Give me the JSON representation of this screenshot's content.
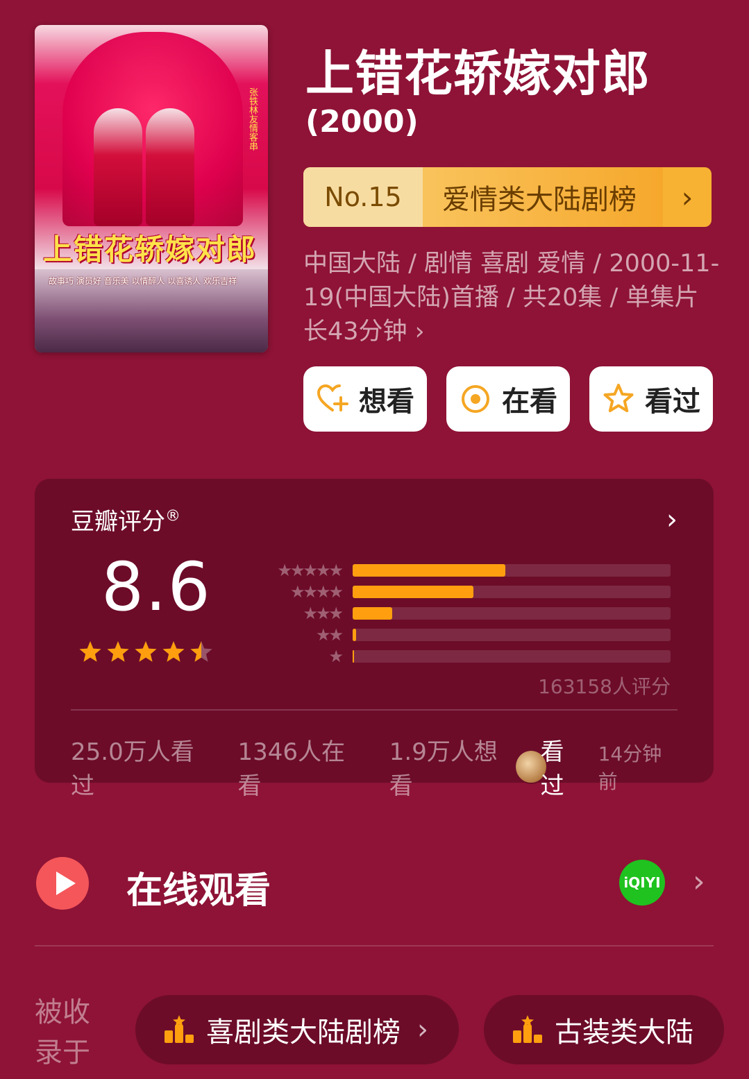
{
  "poster": {
    "title_art": "上错花轿嫁对郎",
    "credits": "故事巧 演员好 音乐美 以情醉人 以喜诱人 欢乐吉祥",
    "side_text": "张铁林友情客串"
  },
  "header": {
    "title": "上错花轿嫁对郎",
    "year": "(2000)"
  },
  "rank": {
    "number": "No.15",
    "name": "爱情类大陆剧榜"
  },
  "meta": {
    "text": "中国大陆 / 剧情 喜剧 爱情 / 2000-11-19(中国大陆)首播 / 共20集 / 单集片长43分钟 ›"
  },
  "actions": {
    "want": "想看",
    "watching": "在看",
    "watched": "看过"
  },
  "rating": {
    "label": "豆瓣评分",
    "reg": "®",
    "score": "8.6",
    "stars": 4.5,
    "distribution": [
      {
        "stars": 5,
        "percent": 48
      },
      {
        "stars": 4,
        "percent": 38
      },
      {
        "stars": 3,
        "percent": 12.5
      },
      {
        "stars": 2,
        "percent": 1
      },
      {
        "stars": 1,
        "percent": 0.5
      }
    ],
    "raters": "163158人评分",
    "counts": {
      "watched": "25.0万人看过",
      "watching": "1346人在看",
      "want": "1.9万人想看",
      "recent_action": "看过",
      "recent_time": "14分钟前"
    }
  },
  "online": {
    "label": "在线观看",
    "provider": "iQIYI"
  },
  "collections": {
    "label": "被收录于",
    "items": [
      "喜剧类大陆剧榜",
      "古装类大陆"
    ]
  },
  "colors": {
    "background": "#8e1336",
    "card": "#6c0c29",
    "accent": "#ff9f0f"
  }
}
